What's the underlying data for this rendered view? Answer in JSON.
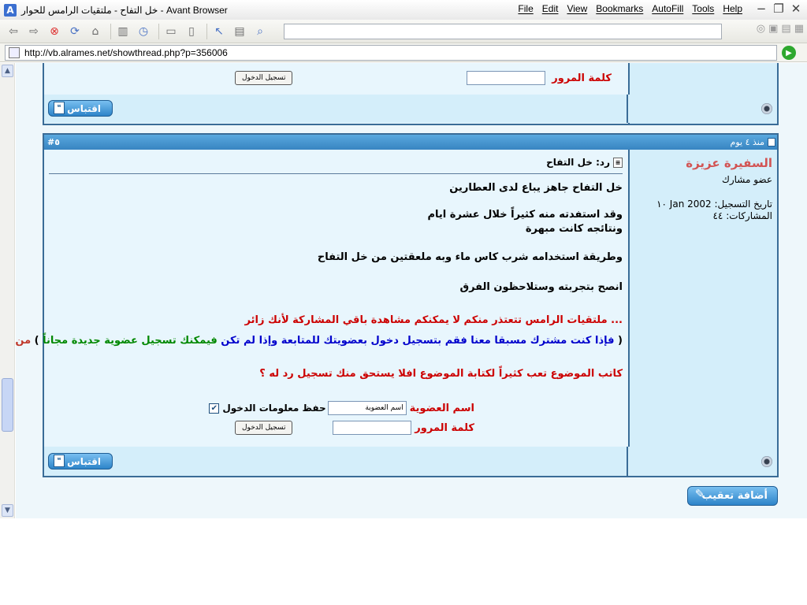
{
  "window": {
    "title": "خل التفاح - ملتقيات الرامس للحوار - Avant Browser",
    "app_icon": "A",
    "menu": [
      "File",
      "Edit",
      "View",
      "Bookmarks",
      "AutoFill",
      "Tools",
      "Help"
    ]
  },
  "address": {
    "url": "http://vb.alrames.net/showthread.php?p=356006"
  },
  "prev_post": {
    "password_label": "كلمة المرور",
    "login_button": "تسجيل الدخول",
    "quote_button": "اقتباس"
  },
  "post": {
    "number": "#٥",
    "date": "منذ ٤ يوم",
    "author": {
      "name": "السفيرة عزيزة",
      "title": "عضو مشارك",
      "join_label": "تاريخ التسجيل:",
      "join_value": "Jan 2002 ١٠",
      "posts_label": "المشاركات:",
      "posts_value": "٤٤"
    },
    "subject": "رد: خل التفاح",
    "body": [
      "خل التفاح جاهز يباع لدى العطارين",
      "وقد استفدته منه كثيراً خلال عشرة ايام",
      "ونتائجه كانت مبهرة",
      "وطريقة استخدامه شرب كاس ماء وبه ملعقتين من خل التفاح",
      "انصح بتجربته وستلاحظون الفرق"
    ],
    "guest_notice": "... ملتقيات الرامس تتعتذر منكم لا يمكنكم مشاهدة باقي المشاركة لأنك زائر",
    "register_parts": {
      "open": "(",
      "blue": "فإذا كنت مشترك مسبقا معنا  فقم بتسجيل دخول بعضويتك للمتابعة وإذا لم تكن",
      "green": "فيمكنك تسجيل عضوية جديدة مجاناً",
      "close": ")",
      "link": "من هنا"
    },
    "encourage": "كاتب الموضوع تعب كثيراً لكتابة الموضوع  افلا يستحق منك تسجيل رد له ؟",
    "login": {
      "username_label": "اسم العضوية",
      "username_value": "اسم العضوية",
      "remember_label": "حفظ معلومات الدخول",
      "password_label": "كلمة المرور",
      "login_button": "تسجيل الدخول"
    },
    "quote_button": "اقتباس"
  },
  "add_reply_button": "أضافة تعقيب",
  "colors": {
    "header": "#3784c1",
    "border": "#3a6c97",
    "panel": "#d4eefa",
    "accent_red": "#cc0000"
  }
}
